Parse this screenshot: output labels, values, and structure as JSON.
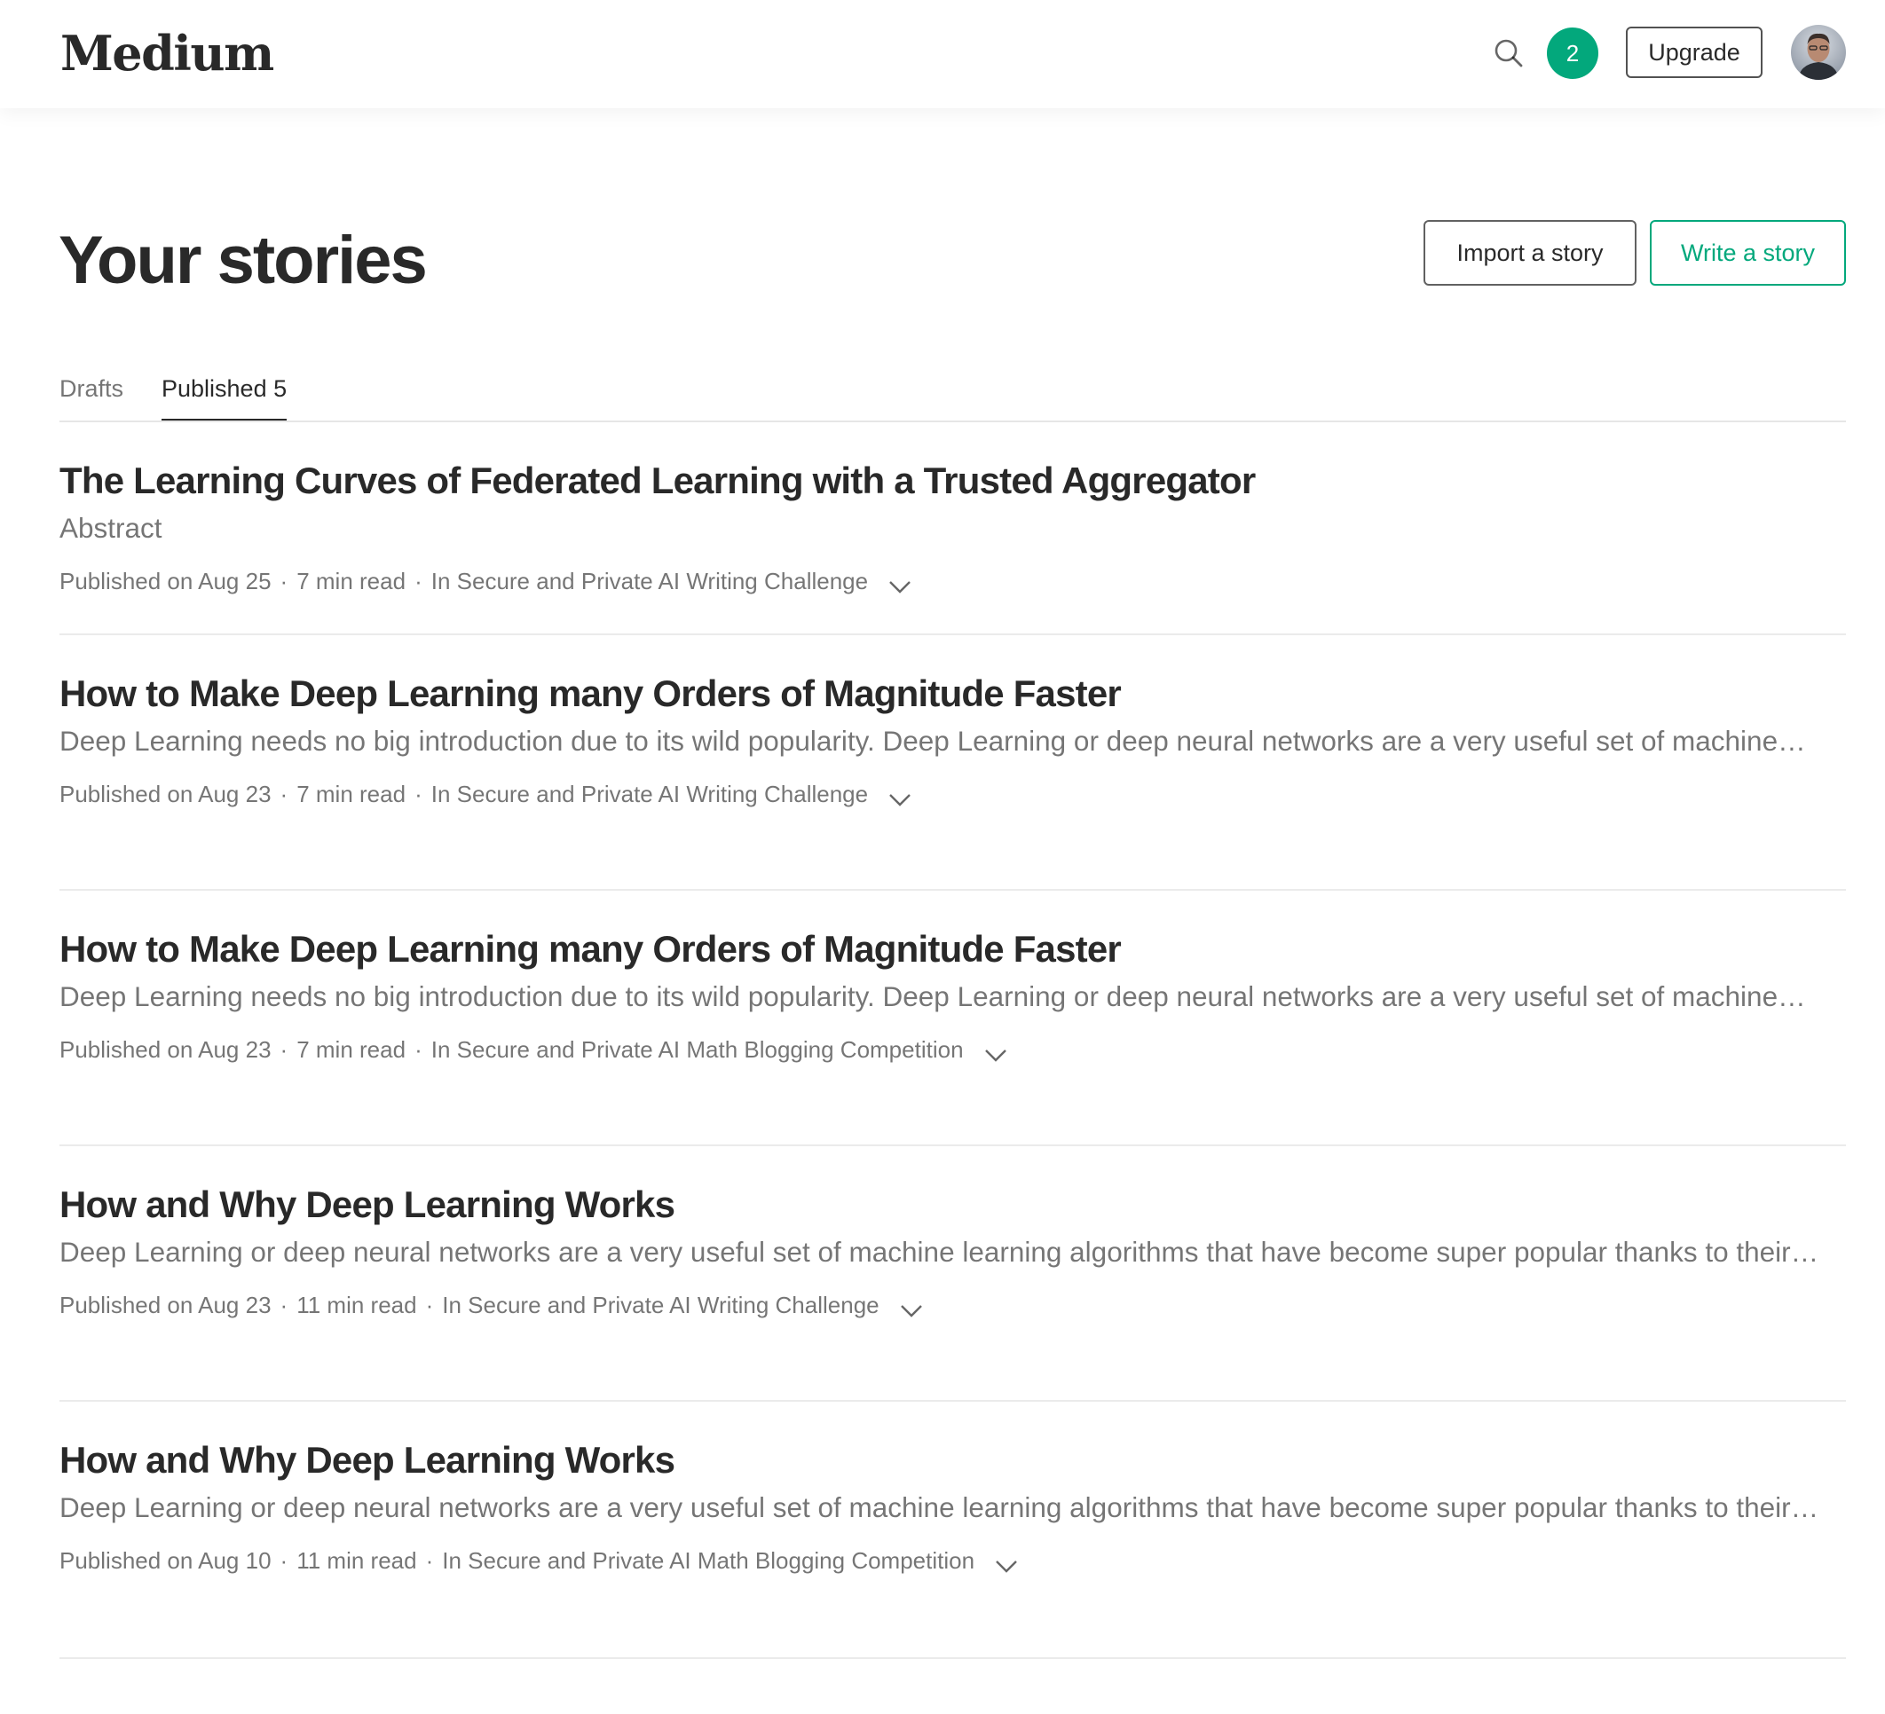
{
  "header": {
    "logo": "Medium",
    "notification_count": "2",
    "upgrade_label": "Upgrade"
  },
  "page": {
    "title": "Your stories",
    "import_label": "Import a story",
    "write_label": "Write a story"
  },
  "tabs": [
    {
      "label": "Drafts",
      "active": false
    },
    {
      "label": "Published 5",
      "active": true
    }
  ],
  "stories": [
    {
      "title": "The Learning Curves of Federated Learning with a Trusted Aggregator",
      "excerpt": "Abstract",
      "published": "Published on Aug 25",
      "read_time": "7 min read",
      "publication": "In Secure and Private AI Writing Challenge"
    },
    {
      "title": "How to Make Deep Learning many Orders of Magnitude Faster",
      "excerpt": "Deep Learning needs no big introduction due to its wild popularity. Deep Learning or deep neural networks are a very useful set of machine…",
      "published": "Published on Aug 23",
      "read_time": "7 min read",
      "publication": "In Secure and Private AI Writing Challenge"
    },
    {
      "title": "How to Make Deep Learning many Orders of Magnitude Faster",
      "excerpt": "Deep Learning needs no big introduction due to its wild popularity. Deep Learning or deep neural networks are a very useful set of machine…",
      "published": "Published on Aug 23",
      "read_time": "7 min read",
      "publication": "In Secure and Private AI Math Blogging Competition"
    },
    {
      "title": "How and Why Deep Learning Works",
      "excerpt": "Deep Learning or deep neural networks are a very useful set of machine learning algorithms that have become super popular thanks to their…",
      "published": "Published on Aug 23",
      "read_time": "11 min read",
      "publication": "In Secure and Private AI Writing Challenge"
    },
    {
      "title": "How and Why Deep Learning Works",
      "excerpt": "Deep Learning or deep neural networks are a very useful set of machine learning algorithms that have become super popular thanks to their…",
      "published": "Published on Aug 10",
      "read_time": "11 min read",
      "publication": "In Secure and Private AI Math Blogging Competition"
    }
  ],
  "colors": {
    "accent": "#03a87c",
    "text_primary": "#292929",
    "text_secondary": "#757575",
    "divider": "#ebebeb"
  },
  "icons": {
    "search": "search-icon",
    "chevron": "chevron-down-icon",
    "avatar": "avatar"
  }
}
